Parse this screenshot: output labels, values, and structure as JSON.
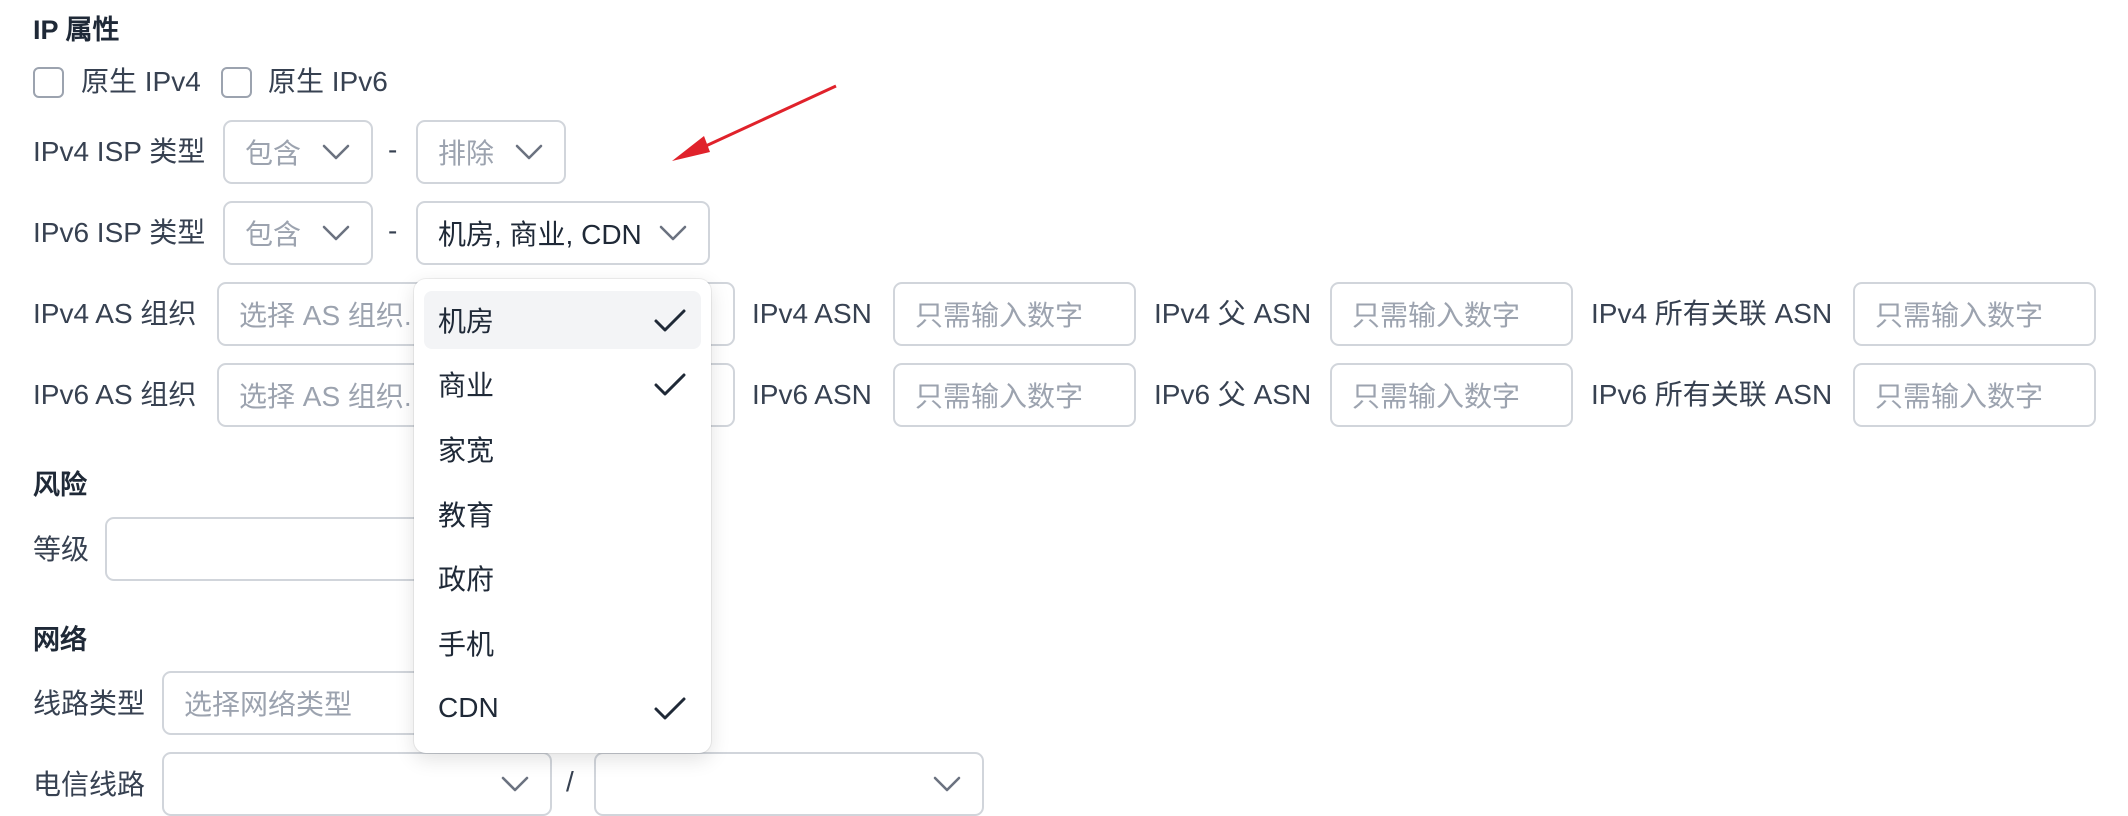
{
  "ip_attr": {
    "title": "IP 属性",
    "native_ipv4": "原生 IPv4",
    "native_ipv6": "原生 IPv6",
    "ipv4_isp": {
      "label": "IPv4 ISP 类型",
      "include_placeholder": "包含",
      "exclude_placeholder": "排除",
      "separator": "-"
    },
    "ipv6_isp": {
      "label": "IPv6 ISP 类型",
      "include_placeholder": "包含",
      "exclude_value": "机房, 商业, CDN",
      "separator": "-"
    },
    "ipv4_as_org": {
      "label": "IPv4 AS 组织",
      "placeholder": "选择 AS 组织..."
    },
    "ipv6_as_org": {
      "label": "IPv6 AS 组织",
      "placeholder": "选择 AS 组织..."
    },
    "ipv4_asn": {
      "label": "IPv4 ASN",
      "placeholder": "只需输入数字"
    },
    "ipv4_parent_asn": {
      "label": "IPv4 父 ASN",
      "placeholder": "只需输入数字"
    },
    "ipv4_all_asn": {
      "label": "IPv4 所有关联 ASN",
      "placeholder": "只需输入数字"
    },
    "ipv6_asn": {
      "label": "IPv6 ASN",
      "placeholder": "只需输入数字"
    },
    "ipv6_parent_asn": {
      "label": "IPv6 父 ASN",
      "placeholder": "只需输入数字"
    },
    "ipv6_all_asn": {
      "label": "IPv6 所有关联 ASN",
      "placeholder": "只需输入数字"
    }
  },
  "risk": {
    "title": "风险",
    "level_label": "等级"
  },
  "network": {
    "title": "网络",
    "line_type_label": "线路类型",
    "line_type_placeholder": "选择网络类型",
    "telecom_label": "电信线路",
    "telecom_separator": "/"
  },
  "dropdown": {
    "options": [
      {
        "label": "机房",
        "checked": true,
        "highlighted": true
      },
      {
        "label": "商业",
        "checked": true,
        "highlighted": false
      },
      {
        "label": "家宽",
        "checked": false,
        "highlighted": false
      },
      {
        "label": "教育",
        "checked": false,
        "highlighted": false
      },
      {
        "label": "政府",
        "checked": false,
        "highlighted": false
      },
      {
        "label": "手机",
        "checked": false,
        "highlighted": false
      },
      {
        "label": "CDN",
        "checked": true,
        "highlighted": false
      }
    ]
  },
  "colors": {
    "arrow": "#e0222b",
    "border": "#d1d5db",
    "placeholder": "#9ca3af",
    "text": "#1f2937",
    "check": "#1f2937"
  },
  "icons": {
    "select_caret": "chevron-down-icon",
    "option_check": "check-icon",
    "annotation": "red-arrow-annotation"
  }
}
